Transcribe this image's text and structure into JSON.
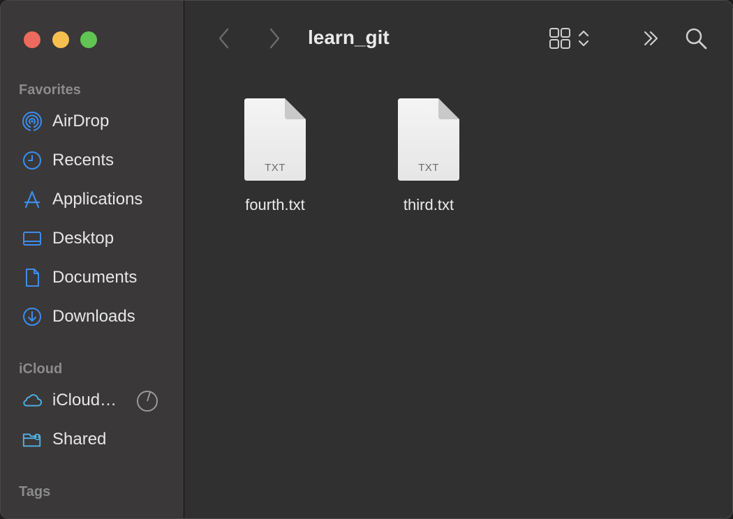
{
  "window": {
    "title": "learn_git"
  },
  "sidebar": {
    "favorites_title": "Favorites",
    "favorites": [
      {
        "label": "AirDrop",
        "icon": "airdrop-icon"
      },
      {
        "label": "Recents",
        "icon": "clock-icon"
      },
      {
        "label": "Applications",
        "icon": "applications-icon"
      },
      {
        "label": "Desktop",
        "icon": "desktop-icon"
      },
      {
        "label": "Documents",
        "icon": "document-icon"
      },
      {
        "label": "Downloads",
        "icon": "download-icon"
      }
    ],
    "icloud_title": "iCloud",
    "icloud": [
      {
        "label": "iCloud…",
        "icon": "cloud-icon"
      },
      {
        "label": "Shared",
        "icon": "shared-folder-icon"
      }
    ],
    "tags_title": "Tags"
  },
  "files": [
    {
      "name": "fourth.txt",
      "ext": "TXT"
    },
    {
      "name": "third.txt",
      "ext": "TXT"
    }
  ],
  "colors": {
    "accent": "#3b8ef0",
    "icloud_accent": "#4fb3e8"
  }
}
